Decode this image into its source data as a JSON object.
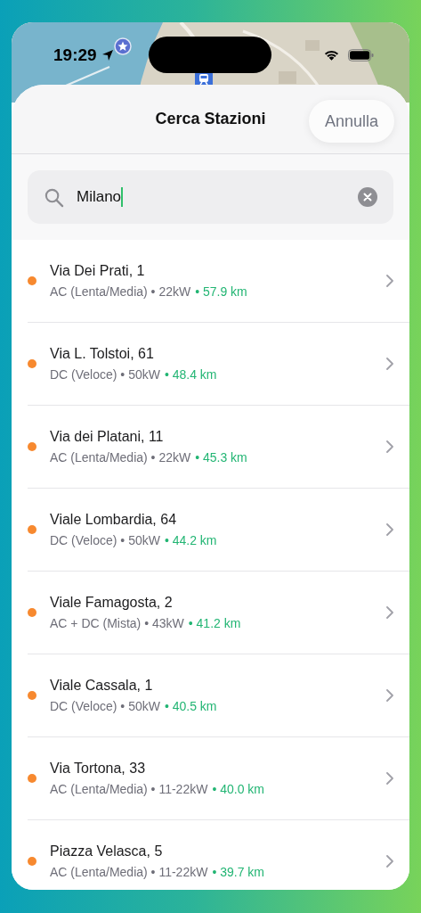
{
  "status_bar": {
    "time": "19:29"
  },
  "header": {
    "title": "Cerca Stazioni",
    "cancel": "Annulla"
  },
  "search": {
    "value": "Milano",
    "focused": true
  },
  "stations": [
    {
      "name": "Via Dei Prati, 1",
      "details": "AC (Lenta/Media) • 22kW",
      "distance": "• 57.9 km"
    },
    {
      "name": "Via L. Tolstoi, 61",
      "details": "DC (Veloce) • 50kW",
      "distance": "• 48.4 km"
    },
    {
      "name": "Via dei Platani, 11",
      "details": "AC (Lenta/Media) • 22kW",
      "distance": "• 45.3 km"
    },
    {
      "name": "Viale Lombardia, 64",
      "details": "DC (Veloce) • 50kW",
      "distance": "• 44.2 km"
    },
    {
      "name": "Viale Famagosta, 2",
      "details": "AC + DC (Mista) • 43kW",
      "distance": "• 41.2 km"
    },
    {
      "name": "Viale Cassala, 1",
      "details": "DC (Veloce) • 50kW",
      "distance": "• 40.5 km"
    },
    {
      "name": "Via Tortona, 33",
      "details": "AC (Lenta/Media) • 11-22kW",
      "distance": "• 40.0 km"
    },
    {
      "name": "Piazza Velasca, 5",
      "details": "AC (Lenta/Media) • 11-22kW",
      "distance": "• 39.7 km"
    }
  ]
}
